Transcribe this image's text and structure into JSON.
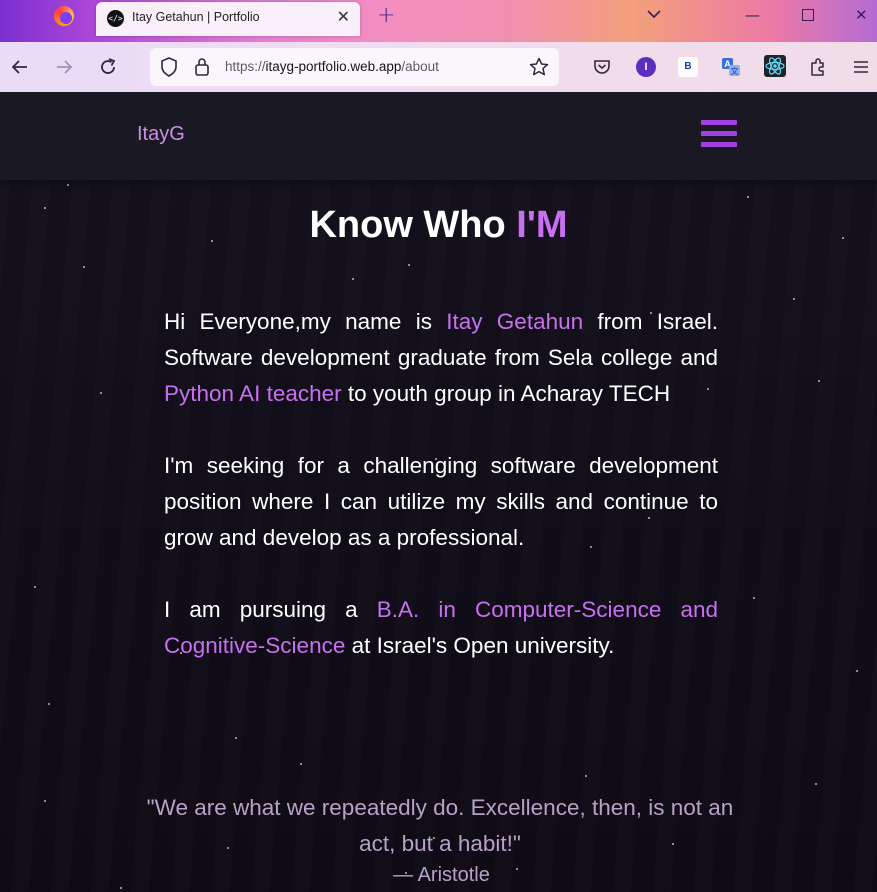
{
  "browser": {
    "tab_title": "Itay Getahun | Portfolio",
    "tab_favicon_text": "</>",
    "url_prefix": "https://",
    "url_domain": "itayg-portfolio.web.app",
    "url_path": "/about",
    "extension_profile_letter": "I",
    "extension_b_letter": "B"
  },
  "site": {
    "brand": "ItayG",
    "heading_part1": "Know Who ",
    "heading_accent": "I'M",
    "about": {
      "p1": {
        "t1": "Hi Everyone,my name is ",
        "h1": "Itay Getahun",
        "t2": " from Israel. Software development graduate from Sela college and ",
        "h2": "Python AI teacher",
        "t3": " to youth group in Acharay TECH"
      },
      "p2": "I'm seeking for a challenging software development position where I can utilize my skills and continue to grow and develop as a professional.",
      "p3": {
        "t1": "I am pursuing a ",
        "h1": "B.A. in Computer-Science and Cognitive-Science",
        "t2": " at Israel's Open university."
      }
    },
    "quote": "\"We are what we repeatedly do. Excellence, then, is not an act, but a habit!\"",
    "quote_author": "— Aristotle"
  },
  "colors": {
    "accent": "#c770f0",
    "brand": "#c98fe3",
    "hamburger": "#a63fe1",
    "quote": "#b7a2c6"
  },
  "icons": {
    "browser": [
      "firefox-icon",
      "close-icon",
      "plus-icon",
      "chevron-down-icon",
      "minimize-icon",
      "maximize-icon",
      "window-close-icon",
      "back-icon",
      "forward-icon",
      "reload-icon",
      "shield-icon",
      "lock-icon",
      "star-icon",
      "pocket-icon",
      "translate-icon",
      "react-devtools-icon",
      "extensions-icon",
      "menu-icon"
    ],
    "site": [
      "hamburger-menu-icon"
    ]
  }
}
